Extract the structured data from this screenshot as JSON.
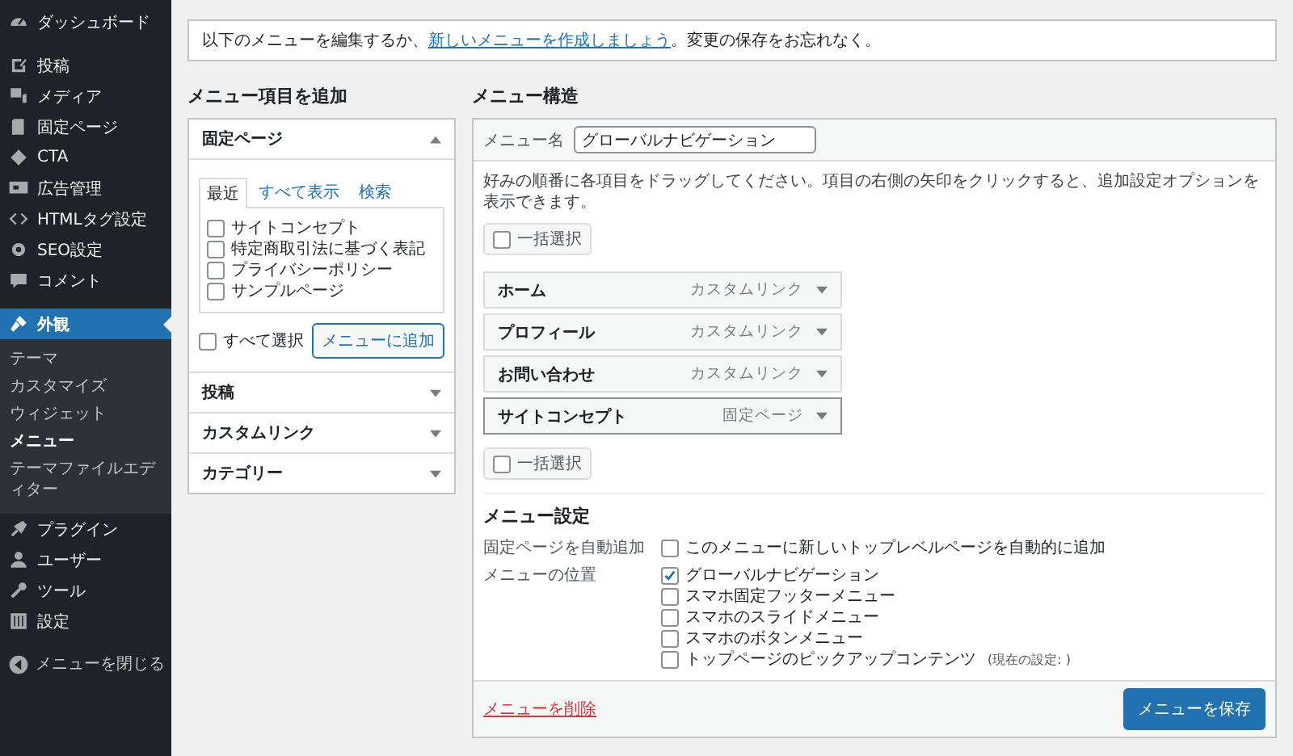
{
  "sidebar": {
    "groups": [
      [
        {
          "label": "ダッシュボード",
          "selected": false
        }
      ],
      [
        {
          "label": "投稿",
          "selected": false
        },
        {
          "label": "メディア",
          "selected": false
        },
        {
          "label": "固定ページ",
          "selected": false
        },
        {
          "label": "CTA",
          "selected": false
        },
        {
          "label": "広告管理",
          "selected": false
        },
        {
          "label": "HTMLタグ設定",
          "selected": false
        },
        {
          "label": "SEO設定",
          "selected": false
        },
        {
          "label": "コメント",
          "selected": false
        }
      ],
      [
        {
          "label": "外観",
          "selected": true,
          "children": [
            {
              "label": "テーマ",
              "selected": false
            },
            {
              "label": "カスタマイズ",
              "selected": false
            },
            {
              "label": "ウィジェット",
              "selected": false
            },
            {
              "label": "メニュー",
              "selected": true
            },
            {
              "label": "テーマファイルエディター",
              "selected": false
            }
          ]
        },
        {
          "label": "プラグイン",
          "selected": false
        },
        {
          "label": "ユーザー",
          "selected": false
        },
        {
          "label": "ツール",
          "selected": false
        },
        {
          "label": "設定",
          "selected": false
        }
      ]
    ],
    "collapse": "メニューを閉じる"
  },
  "notice": {
    "before": "以下のメニューを編集するか、",
    "link": "新しいメニューを作成しましょう",
    "after": "。変更の保存をお忘れなく。"
  },
  "add_items": {
    "heading": "メニュー項目を追加",
    "sections": [
      {
        "title": "固定ページ",
        "expanded": true
      },
      {
        "title": "投稿",
        "expanded": false
      },
      {
        "title": "カスタムリンク",
        "expanded": false
      },
      {
        "title": "カテゴリー",
        "expanded": false
      }
    ],
    "tabs": [
      {
        "label": "最近",
        "selected": true
      },
      {
        "label": "すべて表示",
        "selected": false
      },
      {
        "label": "検索",
        "selected": false
      }
    ],
    "pages": [
      {
        "label": "サイトコンセプト",
        "checked": false
      },
      {
        "label": "特定商取引法に基づく表記",
        "checked": false
      },
      {
        "label": "プライバシーポリシー",
        "checked": false
      },
      {
        "label": "サンプルページ",
        "checked": false
      }
    ],
    "select_all": {
      "label": "すべて選択",
      "checked": false
    },
    "add_button": "メニューに追加"
  },
  "structure": {
    "heading": "メニュー構造",
    "menu_name": {
      "label": "メニュー名",
      "value": "グローバルナビゲーション"
    },
    "instructions": "好みの順番に各項目をドラッグしてください。項目の右側の矢印をクリックすると、追加設定オプションを表示できます。",
    "bulk_top": {
      "label": "一括選択",
      "checked": false
    },
    "items": [
      {
        "title": "ホーム",
        "type": "カスタムリンク",
        "selected": false
      },
      {
        "title": "プロフィール",
        "type": "カスタムリンク",
        "selected": false
      },
      {
        "title": "お問い合わせ",
        "type": "カスタムリンク",
        "selected": false
      },
      {
        "title": "サイトコンセプト",
        "type": "固定ページ",
        "selected": true
      }
    ],
    "bulk_bottom": {
      "label": "一括選択",
      "checked": false
    },
    "settings": {
      "heading": "メニュー設定",
      "rows": [
        {
          "label": "固定ページを自動追加",
          "options": [
            {
              "label": "このメニューに新しいトップレベルページを自動的に追加",
              "checked": false
            }
          ]
        },
        {
          "label": "メニューの位置",
          "options": [
            {
              "label": "グローバルナビゲーション",
              "checked": true
            },
            {
              "label": "スマホ固定フッターメニュー",
              "checked": false
            },
            {
              "label": "スマホのスライドメニュー",
              "checked": false
            },
            {
              "label": "スマホのボタンメニュー",
              "checked": false
            },
            {
              "label": "トップページのピックアップコンテンツ",
              "note": "(現在の設定: )",
              "checked": false
            }
          ]
        }
      ]
    },
    "delete_link": "メニューを削除",
    "save_button": "メニューを保存"
  }
}
